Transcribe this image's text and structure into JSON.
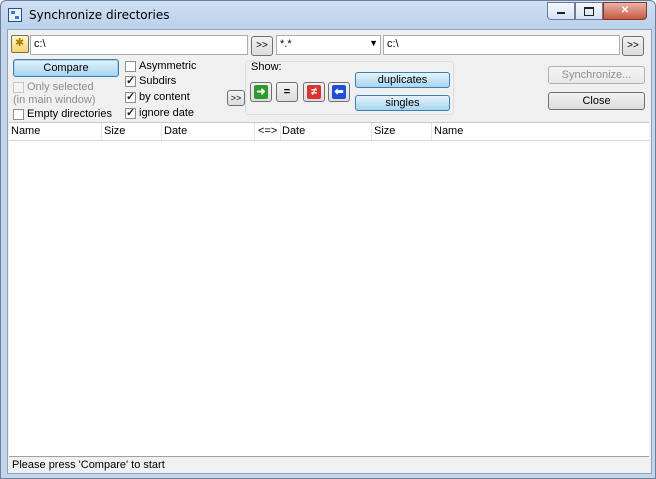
{
  "window": {
    "title": "Synchronize directories",
    "controls": {
      "minimize": "minimize-icon",
      "maximize": "maximize-icon",
      "close": "close-icon"
    }
  },
  "toolbar": {
    "left_path": "c:\\",
    "browse_label": ">>",
    "filter_value": "*.*",
    "right_path": "c:\\",
    "right_browse_label": ">>"
  },
  "options": {
    "compare_label": "Compare",
    "only_selected_label": "Only selected",
    "in_main_window_label": "(in main window)",
    "empty_dirs_label": "Empty directories",
    "asymmetric_label": "Asymmetric",
    "subdirs_label": "Subdirs",
    "by_content_label": "by content",
    "ignore_date_label": "ignore date",
    "more_label": ">>",
    "asymmetric": false,
    "subdirs": true,
    "by_content": true,
    "ignore_date": true,
    "only_selected": false,
    "empty_dirs": false
  },
  "show": {
    "label": "Show:",
    "buttons": [
      "copy-right-icon",
      "equal-icon",
      "not-equal-icon",
      "copy-left-icon"
    ],
    "duplicates_label": "duplicates",
    "singles_label": "singles"
  },
  "actions": {
    "synchronize_label": "Synchronize...",
    "close_label": "Close"
  },
  "list": {
    "columns": [
      "Name",
      "Size",
      "Date",
      "<=>",
      "Date",
      "Size",
      "Name"
    ],
    "rows": []
  },
  "status": {
    "text": "Please press 'Compare' to start"
  },
  "colors": {
    "accent": "#3c7fb1",
    "titlebar": "#b9d1ea"
  }
}
